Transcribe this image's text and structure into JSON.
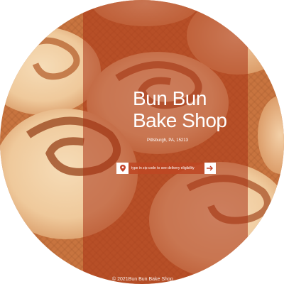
{
  "brand": {
    "name_line1": "Bun Bun",
    "name_line2": "Bake Shop",
    "location": "Pittsburgh, PA, 15213"
  },
  "delivery": {
    "placeholder": "type in zip code to see delivery eligibility",
    "pin_icon": "map-pin-icon",
    "submit_icon": "arrow-right-icon"
  },
  "footer": {
    "copyright": "© 2021Bun Bun Bake Shop"
  },
  "colors": {
    "accent": "#c4452c",
    "overlay_band": "#aa3214",
    "text": "#ffffff"
  }
}
